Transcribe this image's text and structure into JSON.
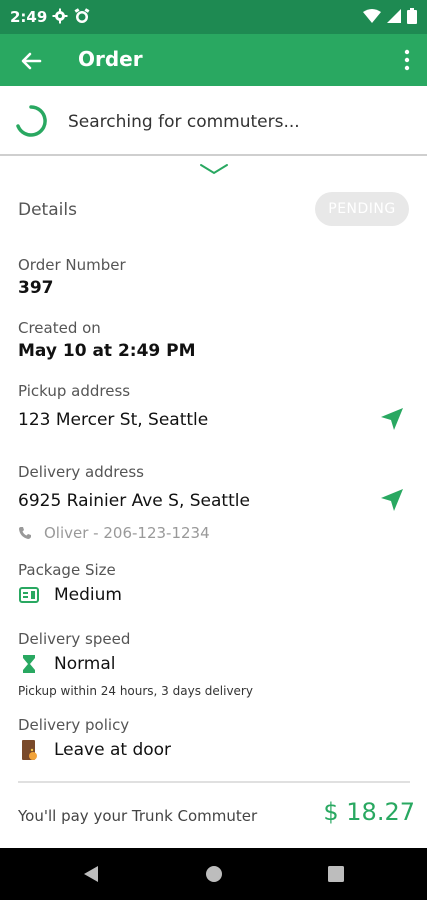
{
  "status": {
    "time": "2:49"
  },
  "app_bar": {
    "title": "Order"
  },
  "search": {
    "text": "Searching for commuters..."
  },
  "details": {
    "title": "Details",
    "status_badge": "PENDING",
    "order_number_label": "Order Number",
    "order_number": "397",
    "created_label": "Created on",
    "created_value": "May 10 at 2:49 PM",
    "pickup_label": "Pickup address",
    "pickup_value": "123 Mercer St, Seattle",
    "delivery_label": "Delivery address",
    "delivery_value": "6925 Rainier Ave S, Seattle",
    "contact": "Oliver - 206-123-1234",
    "package_label": "Package Size",
    "package_value": "Medium",
    "speed_label": "Delivery speed",
    "speed_value": "Normal",
    "speed_note": "Pickup within 24 hours, 3 days delivery",
    "policy_label": "Delivery policy",
    "policy_value": "Leave at door"
  },
  "payment": {
    "label": "You'll pay your Trunk Commuter",
    "amount": "$ 18.27"
  },
  "colors": {
    "status_bar": "#1e8a52",
    "app_bar": "#29a861",
    "accent": "#29a861",
    "badge_bg": "#e8e8e8"
  },
  "icons": {
    "back": "arrow-left-icon",
    "more": "more-vert-icon",
    "spinner": "loading-spinner-icon",
    "chevron": "chevron-down-icon",
    "navigate": "navigation-arrow-icon",
    "phone": "phone-icon",
    "package": "package-size-icon",
    "speed": "hourglass-icon",
    "policy": "door-icon"
  }
}
